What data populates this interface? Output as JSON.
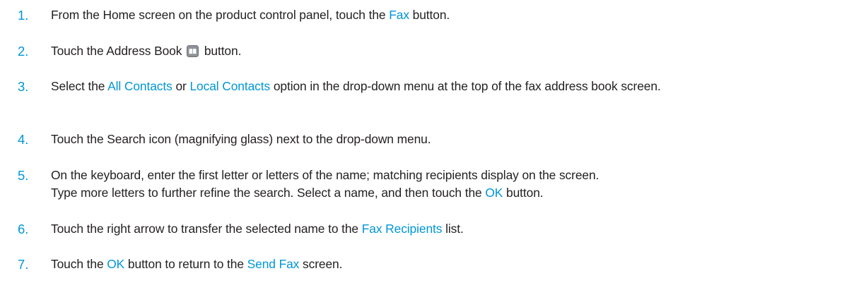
{
  "steps": [
    {
      "number": "1.",
      "before": "From the Home screen on the product control panel, touch the ",
      "link": "Fax",
      "after": " button."
    },
    {
      "number": "2.",
      "before": "Touch the Address Book",
      "icon": "address-book-icon",
      "after": " button."
    },
    {
      "number": "3.",
      "before": "Select the ",
      "link1": "All Contacts",
      "middle": " or ",
      "link2": "Local Contacts",
      "after": " option in the drop-down menu at the top of the fax address book screen."
    },
    {
      "number": "4.",
      "text": "Touch the Search icon (magnifying glass) next to the drop-down menu."
    },
    {
      "number": "5.",
      "line1": "On the keyboard, enter the first letter or letters of the name; matching recipients display on the screen.",
      "before": "Type more letters to further refine the search. Select a name, and then touch the ",
      "link": "OK",
      "after": " button."
    },
    {
      "number": "6.",
      "before": "Touch the right arrow to transfer the selected name to the ",
      "link": "Fax Recipients",
      "after": " list."
    },
    {
      "number": "7.",
      "before": "Touch the ",
      "link1": "OK",
      "middle": " button to return to the ",
      "link2": "Send Fax",
      "after": " screen."
    }
  ],
  "colors": {
    "accent": "#0096d6",
    "text": "#231f20"
  }
}
